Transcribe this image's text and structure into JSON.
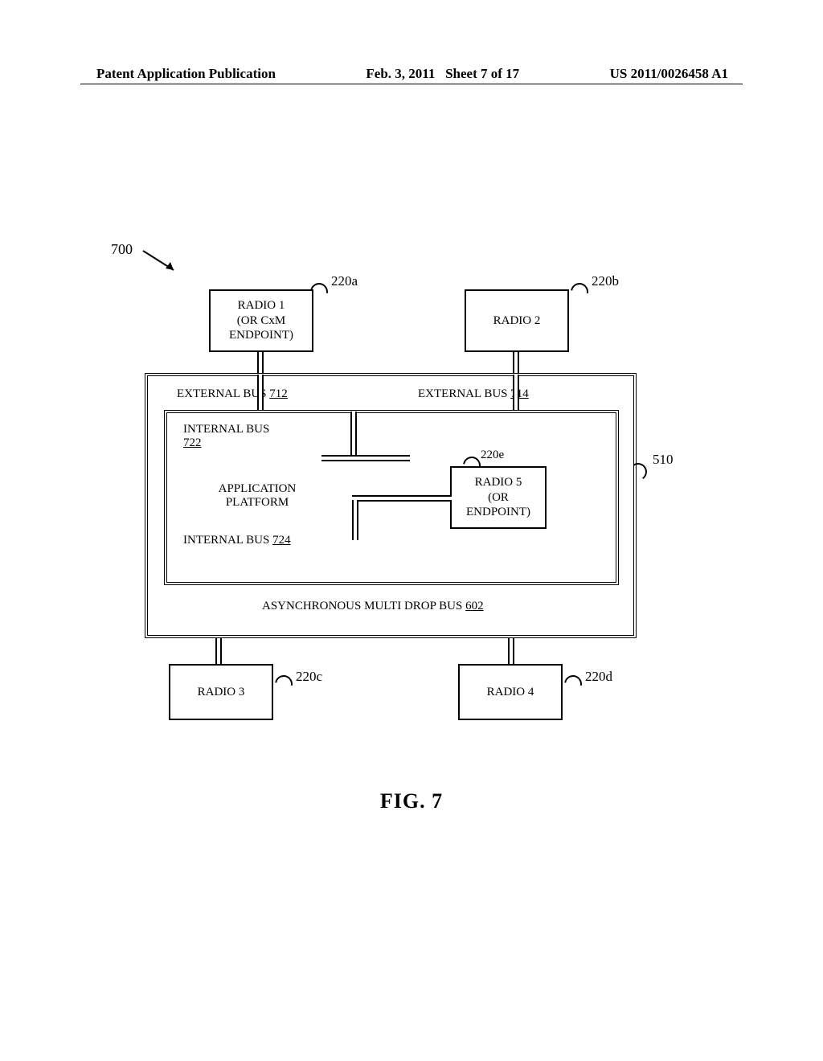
{
  "header": {
    "left": "Patent Application Publication",
    "middle_date": "Feb. 3, 2011",
    "middle_sheet": "Sheet 7 of 17",
    "right": "US 2011/0026458 A1"
  },
  "labels": {
    "ref_700": "700",
    "ref_220a": "220a",
    "ref_220b": "220b",
    "ref_220c": "220c",
    "ref_220d": "220d",
    "ref_220e": "220e",
    "ref_510": "510"
  },
  "boxes": {
    "radio1_line1": "RADIO 1",
    "radio1_line2": "(OR CxM",
    "radio1_line3": "ENDPOINT)",
    "radio2": "RADIO 2",
    "radio3": "RADIO 3",
    "radio4": "RADIO 4",
    "radio5_line1": "RADIO 5",
    "radio5_line2": "(OR",
    "radio5_line3": "ENDPOINT)"
  },
  "buses": {
    "ext_left_text": "EXTERNAL BUS ",
    "ext_left_num": "712",
    "ext_right_text": "EXTERNAL BUS ",
    "ext_right_num": "714",
    "int_top_text": "INTERNAL BUS",
    "int_top_num": "722",
    "app_platform_l1": "APPLICATION",
    "app_platform_l2": "PLATFORM",
    "int_bot_text": "INTERNAL BUS ",
    "int_bot_num": "724",
    "async_text": "ASYNCHRONOUS MULTI DROP BUS ",
    "async_num": "602"
  },
  "figure_caption": "FIG. 7"
}
